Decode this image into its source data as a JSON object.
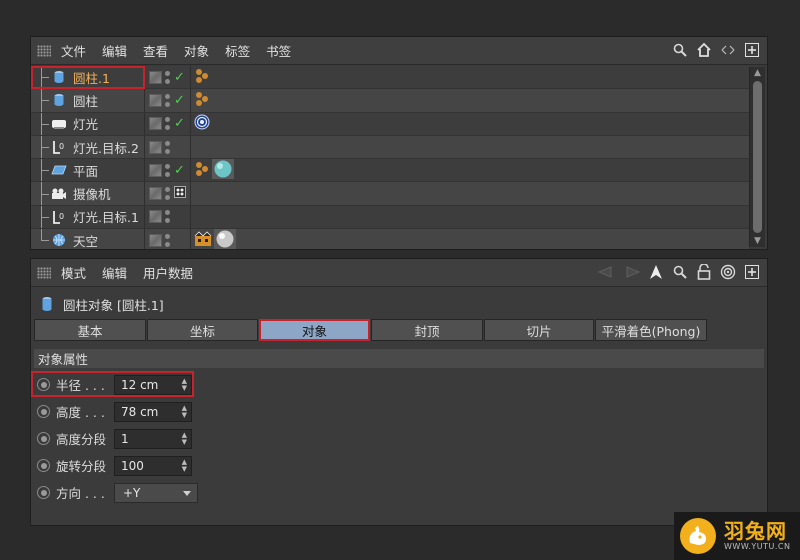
{
  "object_manager": {
    "menu": [
      "文件",
      "编辑",
      "查看",
      "对象",
      "标签",
      "书签"
    ],
    "objects": [
      {
        "name": "圆柱.1",
        "icon": "cylinder-icon",
        "selected": true,
        "check": true,
        "tags": [
          "phong-tag-icon"
        ]
      },
      {
        "name": "圆柱",
        "icon": "cylinder-icon",
        "selected": false,
        "check": true,
        "tags": [
          "phong-tag-icon"
        ]
      },
      {
        "name": "灯光",
        "icon": "light-icon",
        "selected": false,
        "check": true,
        "tags": [
          "target-tag-icon"
        ]
      },
      {
        "name": "灯光.目标.2",
        "icon": "null-icon",
        "selected": false,
        "check": false,
        "tags": []
      },
      {
        "name": "平面",
        "icon": "plane-icon",
        "selected": false,
        "check": true,
        "tags": [
          "phong-tag-icon",
          "material-teal-icon"
        ]
      },
      {
        "name": "摄像机",
        "icon": "camera-icon",
        "selected": false,
        "check": false,
        "camera_toggle": true,
        "tags": []
      },
      {
        "name": "灯光.目标.1",
        "icon": "null-icon",
        "selected": false,
        "check": false,
        "tags": []
      },
      {
        "name": "天空",
        "icon": "sky-icon",
        "selected": false,
        "check": false,
        "tags": [
          "compositing-tag-icon",
          "material-white-icon"
        ]
      }
    ]
  },
  "attribute_manager": {
    "menu": [
      "模式",
      "编辑",
      "用户数据"
    ],
    "object_title": "圆柱对象 [圆柱.1]",
    "tabs": [
      {
        "label": "基本",
        "active": false
      },
      {
        "label": "坐标",
        "active": false
      },
      {
        "label": "对象",
        "active": true
      },
      {
        "label": "封顶",
        "active": false
      },
      {
        "label": "切片",
        "active": false
      },
      {
        "label": "平滑着色(Phong)",
        "active": false
      }
    ],
    "section_title": "对象属性",
    "params": [
      {
        "label": "半径 . . .",
        "value": "12 cm",
        "type": "number"
      },
      {
        "label": "高度 . . .",
        "value": "78 cm",
        "type": "number"
      },
      {
        "label": "高度分段",
        "value": "1",
        "type": "number"
      },
      {
        "label": "旋转分段",
        "value": "100",
        "type": "number"
      },
      {
        "label": "方向 . . .",
        "value": "+Y",
        "type": "dropdown"
      }
    ]
  },
  "watermark": {
    "cn": "羽兔网",
    "en": "WWW.YUTU.CN"
  },
  "colors": {
    "selection_red": "#c8232c",
    "active_tab": "#8da6c6",
    "selected_name": "#f2b25a",
    "check_green": "#4fd04f"
  }
}
